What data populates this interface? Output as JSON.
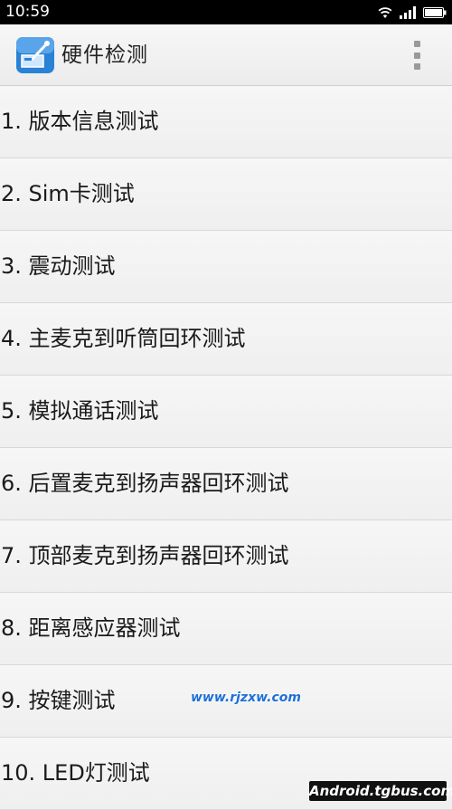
{
  "status_bar": {
    "time": "10:59",
    "icons": [
      "wifi-icon",
      "signal-icon",
      "battery-icon"
    ]
  },
  "app_bar": {
    "title": "硬件检测",
    "icon": "hardware-test-app-icon",
    "menu_icon": "overflow-menu-icon"
  },
  "tests": [
    {
      "label": "1. 版本信息测试"
    },
    {
      "label": "2. Sim卡测试"
    },
    {
      "label": "3. 震动测试"
    },
    {
      "label": "4. 主麦克到听筒回环测试"
    },
    {
      "label": "5. 模拟通话测试"
    },
    {
      "label": "6. 后置麦克到扬声器回环测试"
    },
    {
      "label": "7. 顶部麦克到扬声器回环测试"
    },
    {
      "label": "8. 距离感应器测试"
    },
    {
      "label": "9. 按键测试"
    },
    {
      "label": "10. LED灯测试"
    }
  ],
  "watermarks": {
    "site": "www.rjzxw.com",
    "badge": "Android.tgbus.com"
  },
  "colors": {
    "status_bar": "#000000",
    "app_bar": "#f2f2f2",
    "list_background": "#f2f2f2",
    "text": "#1a1a1a",
    "divider": "#d8d8d8",
    "app_icon_blue": "#2a82d6"
  }
}
